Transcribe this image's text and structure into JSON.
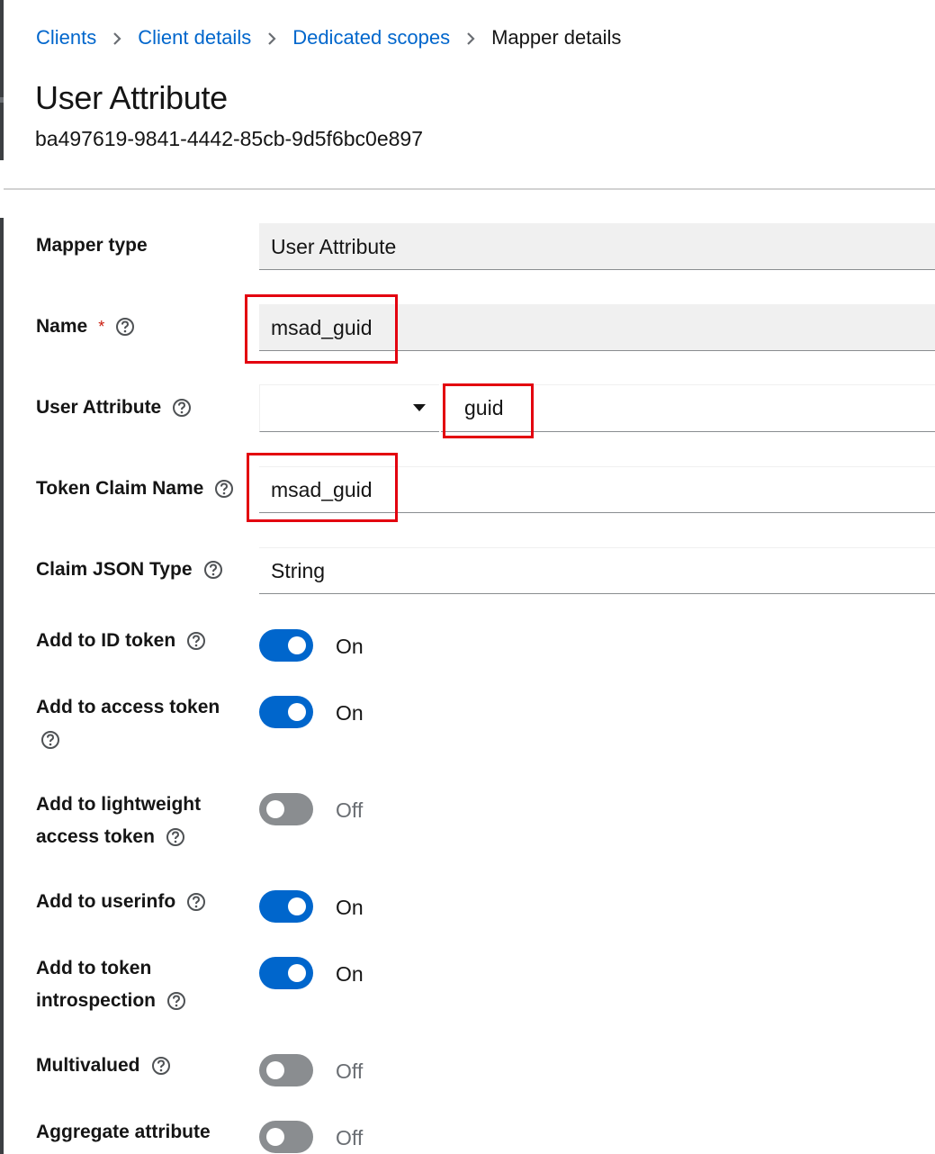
{
  "breadcrumb": {
    "items": [
      "Clients",
      "Client details",
      "Dedicated scopes"
    ],
    "current": "Mapper details"
  },
  "header": {
    "title": "User Attribute",
    "subtitle": "ba497619-9841-4442-85cb-9d5f6bc0e897"
  },
  "form": {
    "mapper_type": {
      "label": "Mapper type",
      "value": "User Attribute"
    },
    "name": {
      "label": "Name",
      "required_mark": "*",
      "value": "msad_guid"
    },
    "user_attribute": {
      "label": "User Attribute",
      "value": "guid"
    },
    "token_claim_name": {
      "label": "Token Claim Name",
      "value": "msad_guid"
    },
    "claim_json_type": {
      "label": "Claim JSON Type",
      "value": "String"
    },
    "switches": [
      {
        "label": "Add to ID token",
        "state": "On",
        "on": true
      },
      {
        "label_line1": "Add to access token",
        "state": "On",
        "on": true
      },
      {
        "label_line1": "Add to lightweight",
        "label_line2": "access token",
        "state": "Off",
        "on": false
      },
      {
        "label": "Add to userinfo",
        "state": "On",
        "on": true
      },
      {
        "label_line1": "Add to token",
        "label_line2": "introspection",
        "state": "On",
        "on": true
      },
      {
        "label": "Multivalued",
        "state": "Off",
        "on": false
      },
      {
        "label": "Aggregate attribute",
        "state": "Off",
        "on": false
      }
    ]
  },
  "colors": {
    "link": "#0066cc",
    "switch_on": "#0066cc",
    "switch_off": "#8a8d90",
    "highlight": "#e3000f",
    "required": "#c9190b"
  }
}
